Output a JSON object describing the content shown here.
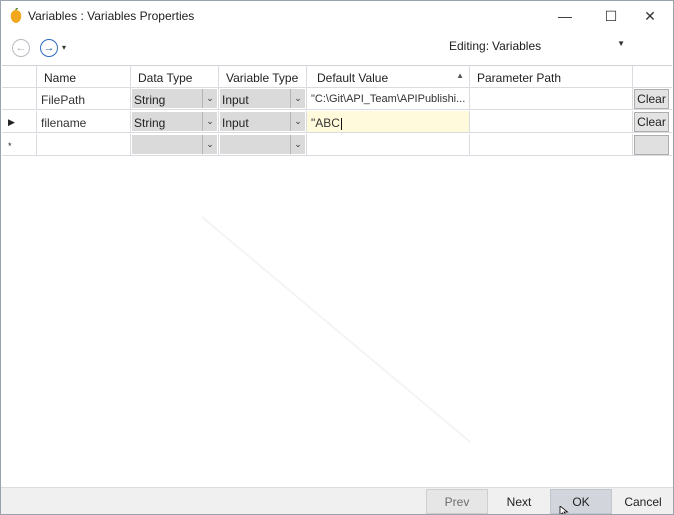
{
  "window": {
    "title": "Variables : Variables Properties",
    "controls": {
      "minimize": "—",
      "maximize": "☐",
      "close": "✕"
    }
  },
  "toolbar": {
    "back_icon": "←",
    "forward_icon": "→",
    "dropdown_icon": "▾",
    "editing_label": "Editing:",
    "editing_value": "Variables"
  },
  "grid": {
    "headers": [
      "Name",
      "Data Type",
      "Variable Type",
      "Default Value",
      "Parameter Path"
    ],
    "sort_indicator": "▲",
    "rows": [
      {
        "marker": "",
        "name": "FilePath",
        "data_type": "String",
        "variable_type": "Input",
        "default_value": "\"C:\\Git\\API_Team\\APIPublishi...",
        "parameter_path": "",
        "clear": "Clear"
      },
      {
        "marker": "▶",
        "name": "filename",
        "data_type": "String",
        "variable_type": "Input",
        "default_value": "\"ABC",
        "parameter_path": "",
        "clear": "Clear"
      },
      {
        "marker": "*",
        "name": "",
        "data_type": "",
        "variable_type": "",
        "default_value": "",
        "parameter_path": "",
        "clear": ""
      }
    ]
  },
  "buttons": {
    "prev": "Prev",
    "next": "Next",
    "ok": "OK",
    "cancel": "Cancel"
  },
  "colors": {
    "accent": "#1f5fb0",
    "editing_cell": "#fffadb",
    "combo_bg": "#dadada"
  }
}
